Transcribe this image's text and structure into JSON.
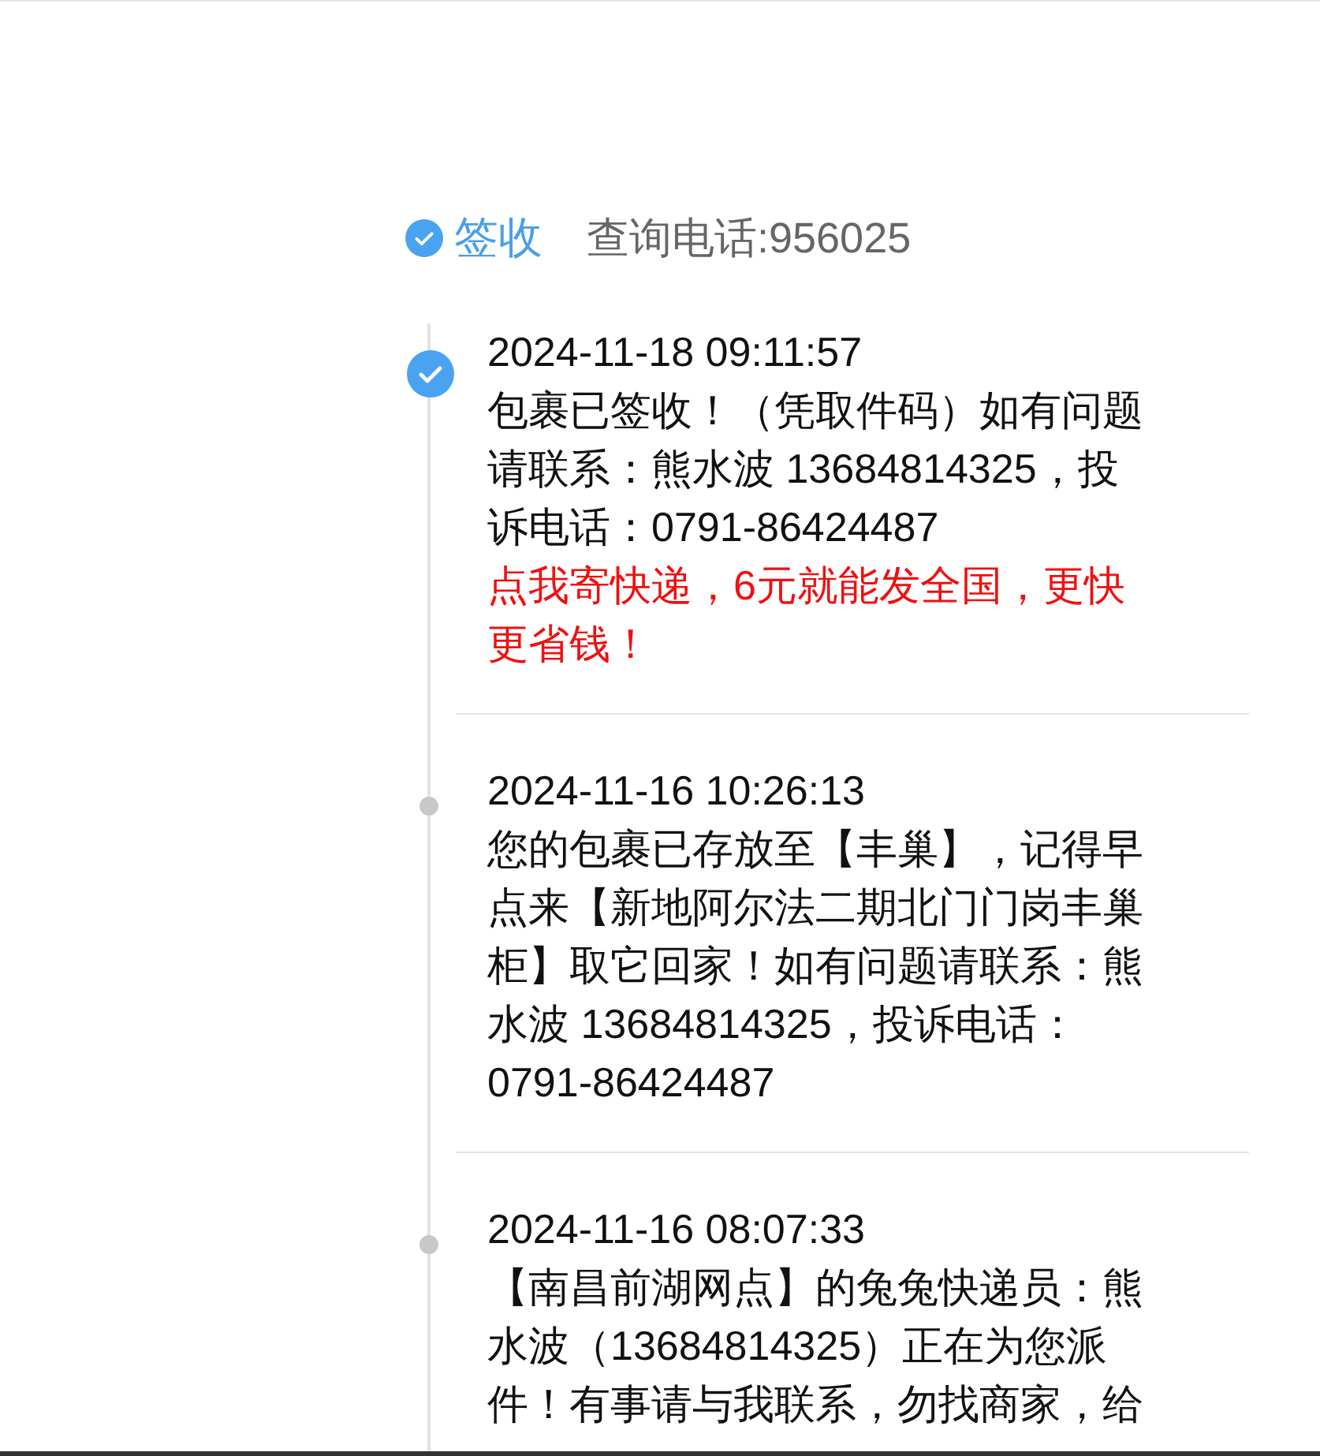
{
  "status": {
    "label": "签收",
    "phone": "查询电话:956025"
  },
  "events": [
    {
      "current": true,
      "time": "2024-11-18 09:11:57",
      "lines": [
        "包裹已签收！（凭取件码）如有问题",
        "请联系：熊水波 13684814325，投",
        "诉电话：0791-86424487"
      ],
      "promo": [
        "点我寄快递，6元就能发全国，更快",
        "更省钱！"
      ]
    },
    {
      "current": false,
      "time": "2024-11-16 10:26:13",
      "lines": [
        "您的包裹已存放至【丰巢】，记得早",
        "点来【新地阿尔法二期北门门岗丰巢",
        "柜】取它回家！如有问题请联系：熊",
        "水波 13684814325，投诉电话：",
        "0791-86424487"
      ]
    },
    {
      "current": false,
      "time": "2024-11-16 08:07:33",
      "lines": [
        "【南昌前湖网点】的兔兔快递员：熊",
        "水波（13684814325）正在为您派",
        "件！有事请与我联系，勿找商家，给"
      ]
    }
  ]
}
